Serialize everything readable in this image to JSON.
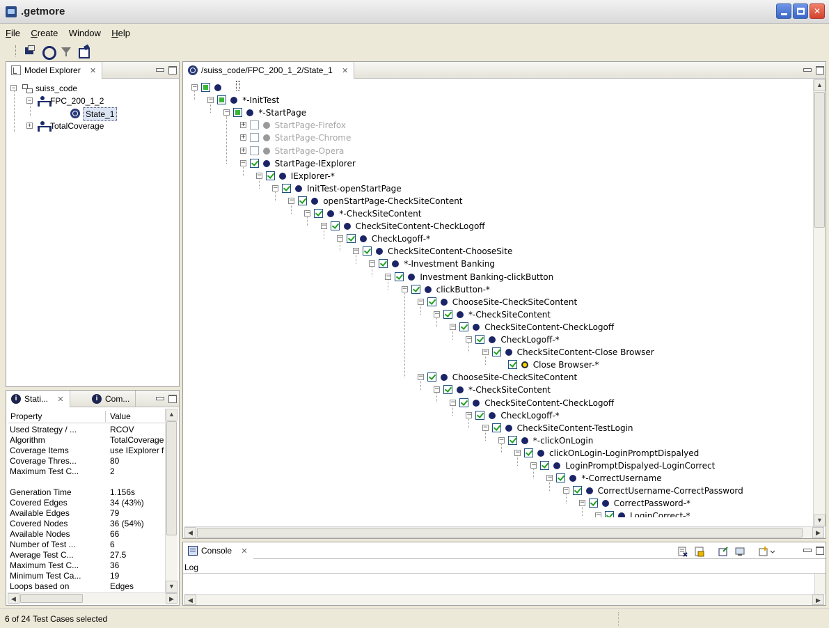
{
  "window": {
    "title": ".getmore"
  },
  "menu": [
    {
      "label": "File",
      "mnemonic": "F",
      "rest": "ile"
    },
    {
      "label": "Create",
      "mnemonic": "C",
      "rest": "reate"
    },
    {
      "label": "Window",
      "mnemonic": "",
      "rest": "Window"
    },
    {
      "label": "Help",
      "mnemonic": "H",
      "rest": "elp"
    }
  ],
  "toolbar": {
    "icons": [
      "model-icon",
      "run-icon",
      "filter-icon",
      "export-icon"
    ]
  },
  "model_explorer": {
    "tab_label": "Model Explorer",
    "tree": [
      {
        "label": "suiss_code",
        "icon": "project-icon",
        "expander": "−"
      },
      {
        "label": "FPC_200_1_2",
        "icon": "model-icon",
        "expander": "−"
      },
      {
        "label": "State_1",
        "icon": "state-icon",
        "expander": ""
      },
      {
        "label": "TotalCoverage",
        "icon": "model-icon",
        "expander": "+"
      }
    ]
  },
  "properties": {
    "tab1_label": "Stati...",
    "tab2_label": "Com...",
    "columns": [
      "Property",
      "Value"
    ],
    "rows": [
      {
        "key": "Used Strategy / ...",
        "value": "RCOV"
      },
      {
        "key": "Algorithm",
        "value": "TotalCoverage"
      },
      {
        "key": "Coverage Items",
        "value": "use IExplorer f"
      },
      {
        "key": "Coverage Thres...",
        "value": "80"
      },
      {
        "key": "Maximum Test C...",
        "value": "2"
      },
      {
        "key": "",
        "value": ""
      },
      {
        "key": "Generation Time",
        "value": "1.156s"
      },
      {
        "key": "Covered Edges",
        "value": "34 (43%)"
      },
      {
        "key": "Available Edges",
        "value": "79"
      },
      {
        "key": "Covered Nodes",
        "value": "36 (54%)"
      },
      {
        "key": "Available Nodes",
        "value": "66"
      },
      {
        "key": "Number of Test ...",
        "value": "6"
      },
      {
        "key": "Average Test C...",
        "value": "27.5"
      },
      {
        "key": "Maximum Test C...",
        "value": "36"
      },
      {
        "key": "Minimum Test Ca...",
        "value": "19"
      },
      {
        "key": "Loops based on",
        "value": "Edges"
      }
    ]
  },
  "editor": {
    "tab_label": "/suiss_code/FPC_200_1_2/State_1",
    "tree": [
      {
        "d": 0,
        "label": "",
        "check": "partial",
        "dot": "navy",
        "exp": "−"
      },
      {
        "d": 1,
        "label": "*-InitTest",
        "check": "partial",
        "dot": "navy",
        "exp": "−"
      },
      {
        "d": 2,
        "label": "*-StartPage",
        "check": "partial",
        "dot": "navy",
        "exp": "−"
      },
      {
        "d": 3,
        "label": "StartPage-Firefox",
        "check": "none",
        "dot": "grey",
        "exp": "+",
        "disabled": true
      },
      {
        "d": 3,
        "label": "StartPage-Chrome",
        "check": "none",
        "dot": "grey",
        "exp": "+",
        "disabled": true
      },
      {
        "d": 3,
        "label": "StartPage-Opera",
        "check": "none",
        "dot": "grey",
        "exp": "+",
        "disabled": true
      },
      {
        "d": 3,
        "label": "StartPage-IExplorer",
        "check": "checked",
        "dot": "navy",
        "exp": "−"
      },
      {
        "d": 4,
        "label": "IExplorer-*",
        "check": "checked",
        "dot": "navy",
        "exp": "−"
      },
      {
        "d": 5,
        "label": "InitTest-openStartPage",
        "check": "checked",
        "dot": "navy",
        "exp": "−"
      },
      {
        "d": 6,
        "label": "openStartPage-CheckSiteContent",
        "check": "checked",
        "dot": "navy",
        "exp": "−"
      },
      {
        "d": 7,
        "label": "*-CheckSiteContent",
        "check": "checked",
        "dot": "navy",
        "exp": "−"
      },
      {
        "d": 8,
        "label": "CheckSiteContent-CheckLogoff",
        "check": "checked",
        "dot": "navy",
        "exp": "−"
      },
      {
        "d": 9,
        "label": "CheckLogoff-*",
        "check": "checked",
        "dot": "navy",
        "exp": "−"
      },
      {
        "d": 10,
        "label": "CheckSiteContent-ChooseSite",
        "check": "checked",
        "dot": "navy",
        "exp": "−"
      },
      {
        "d": 11,
        "label": "*-Investment Banking",
        "check": "checked",
        "dot": "navy",
        "exp": "−"
      },
      {
        "d": 12,
        "label": "Investment Banking-clickButton",
        "check": "checked",
        "dot": "navy",
        "exp": "−"
      },
      {
        "d": 13,
        "label": "clickButton-*",
        "check": "checked",
        "dot": "navy",
        "exp": "−"
      },
      {
        "d": 14,
        "label": "ChooseSite-CheckSiteContent",
        "check": "checked",
        "dot": "navy",
        "exp": "−"
      },
      {
        "d": 15,
        "label": "*-CheckSiteContent",
        "check": "checked",
        "dot": "navy",
        "exp": "−"
      },
      {
        "d": 16,
        "label": "CheckSiteContent-CheckLogoff",
        "check": "checked",
        "dot": "navy",
        "exp": "−"
      },
      {
        "d": 17,
        "label": "CheckLogoff-*",
        "check": "checked",
        "dot": "navy",
        "exp": "−"
      },
      {
        "d": 18,
        "label": "CheckSiteContent-Close Browser",
        "check": "checked",
        "dot": "navy",
        "exp": "−"
      },
      {
        "d": 19,
        "label": "Close Browser-*",
        "check": "checked",
        "dot": "yellow",
        "exp": ""
      },
      {
        "d": 14,
        "label": "ChooseSite-CheckSiteContent",
        "check": "checked",
        "dot": "navy",
        "exp": "−"
      },
      {
        "d": 15,
        "label": "*-CheckSiteContent",
        "check": "checked",
        "dot": "navy",
        "exp": "−"
      },
      {
        "d": 16,
        "label": "CheckSiteContent-CheckLogoff",
        "check": "checked",
        "dot": "navy",
        "exp": "−"
      },
      {
        "d": 17,
        "label": "CheckLogoff-*",
        "check": "checked",
        "dot": "navy",
        "exp": "−"
      },
      {
        "d": 18,
        "label": "CheckSiteContent-TestLogin",
        "check": "checked",
        "dot": "navy",
        "exp": "−"
      },
      {
        "d": 19,
        "label": "*-clickOnLogin",
        "check": "checked",
        "dot": "navy",
        "exp": "−"
      },
      {
        "d": 20,
        "label": "clickOnLogin-LoginPromptDispalyed",
        "check": "checked",
        "dot": "navy",
        "exp": "−"
      },
      {
        "d": 21,
        "label": "LoginPromptDispalyed-LoginCorrect",
        "check": "checked",
        "dot": "navy",
        "exp": "−"
      },
      {
        "d": 22,
        "label": "*-CorrectUsername",
        "check": "checked",
        "dot": "navy",
        "exp": "−"
      },
      {
        "d": 23,
        "label": "CorrectUsername-CorrectPassword",
        "check": "checked",
        "dot": "navy",
        "exp": "−"
      },
      {
        "d": 24,
        "label": "CorrectPassword-*",
        "check": "checked",
        "dot": "navy",
        "exp": "−"
      },
      {
        "d": 25,
        "label": "LoginCorrect-*",
        "check": "checked",
        "dot": "navy",
        "exp": "−"
      }
    ]
  },
  "console": {
    "tab_label": "Console",
    "log_label": "Log",
    "tool_icons": [
      "clear-console-icon",
      "scroll-lock-icon",
      "pin-console-icon",
      "display-console-icon",
      "open-console-icon"
    ]
  },
  "status": {
    "text": "6 of 24 Test Cases selected"
  },
  "colors": {
    "navy_dot": "#1b2466",
    "check_green": "#21a121",
    "selection": "#dbe4f3"
  }
}
